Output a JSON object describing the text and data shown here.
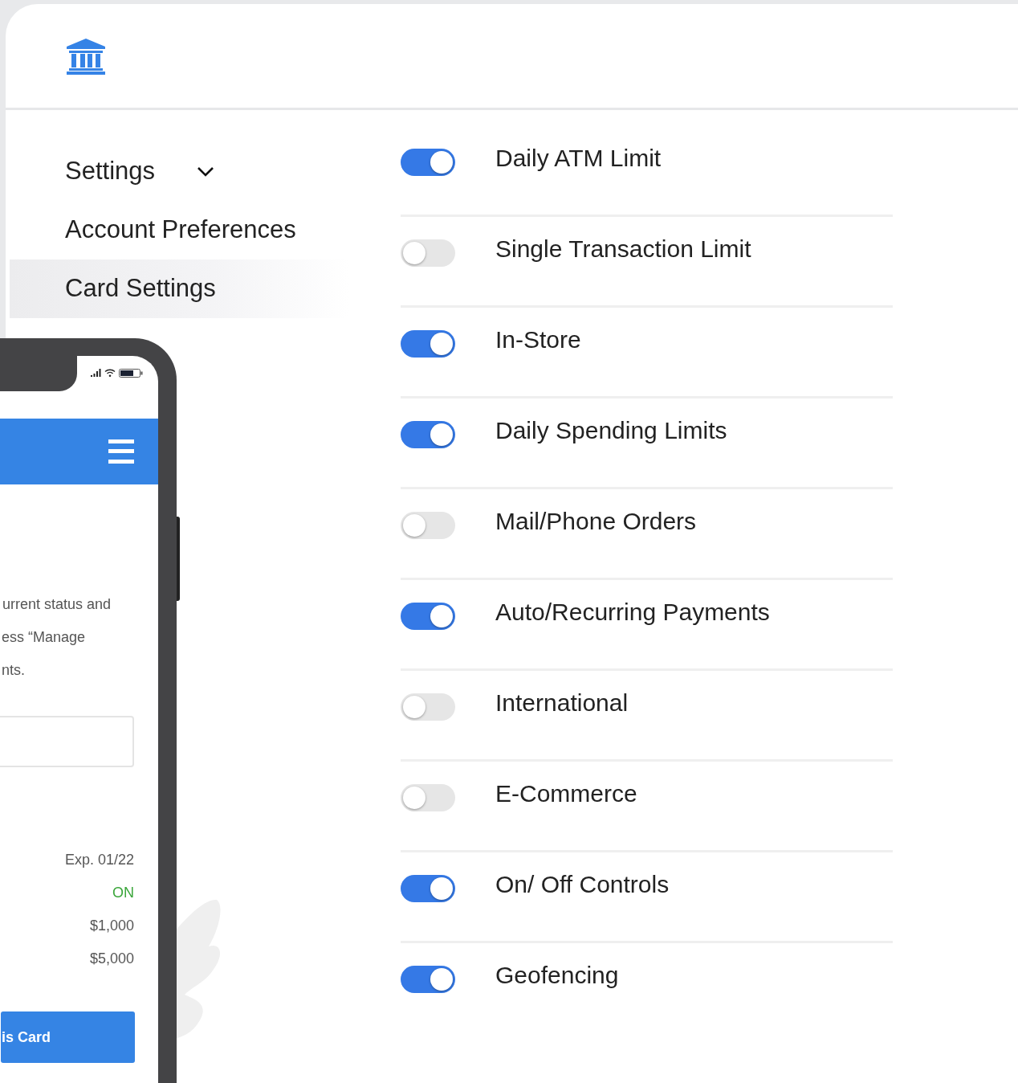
{
  "sidebar": {
    "header": {
      "label": "Settings",
      "expanded": true
    },
    "items": [
      {
        "label": "Account Preferences",
        "selected": false
      },
      {
        "label": "Card Settings",
        "selected": true
      }
    ]
  },
  "controls": [
    {
      "label": "Daily ATM Limit",
      "on": true
    },
    {
      "label": "Single Transaction Limit",
      "on": false
    },
    {
      "label": "In-Store",
      "on": true
    },
    {
      "label": "Daily Spending Limits",
      "on": true
    },
    {
      "label": "Mail/Phone Orders",
      "on": false
    },
    {
      "label": "Auto/Recurring Payments",
      "on": true
    },
    {
      "label": "International",
      "on": false
    },
    {
      "label": "E-Commerce",
      "on": false
    },
    {
      "label": "On/ Off Controls",
      "on": true
    },
    {
      "label": "Geofencing",
      "on": true
    }
  ],
  "phone": {
    "description_lines": [
      "urrent status and",
      "ess “Manage",
      "nts."
    ],
    "details": [
      {
        "text": "Exp. 01/22",
        "kind": "plain"
      },
      {
        "text": "ON",
        "kind": "status"
      },
      {
        "text": "$1,000",
        "kind": "plain"
      },
      {
        "text": "$5,000",
        "kind": "plain"
      }
    ],
    "button": "is Card"
  }
}
